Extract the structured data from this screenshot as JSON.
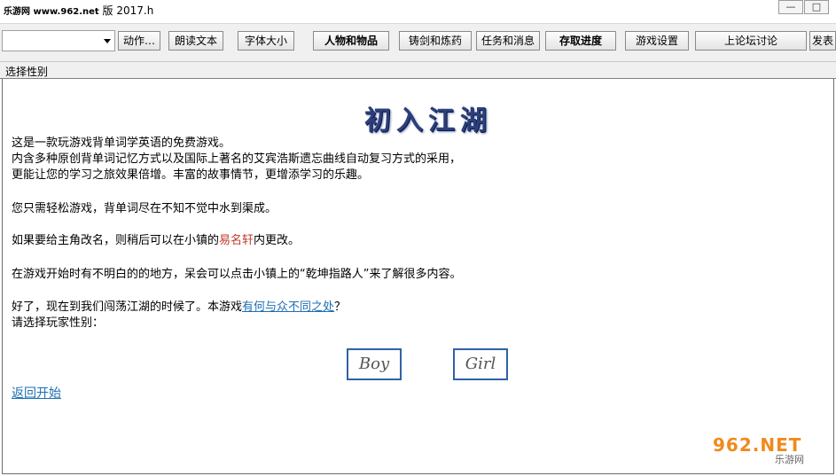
{
  "titlebar": {
    "site_label": "乐游网 www.962.net",
    "title_suffix": "版 2017.h",
    "minimize_glyph": "—",
    "maximize_glyph": "□"
  },
  "toolbar": {
    "combo_value": "",
    "buttons": [
      {
        "label": "动作…"
      },
      {
        "label": "朗读文本"
      },
      {
        "label": "字体大小"
      },
      {
        "label": "人物和物品"
      },
      {
        "label": "铸剑和炼药"
      },
      {
        "label": "任务和消息"
      },
      {
        "label": "存取进度"
      },
      {
        "label": "游戏设置"
      },
      {
        "label": "上论坛讨论"
      },
      {
        "label": "发表"
      }
    ]
  },
  "section_label": "选择性别",
  "content": {
    "heading": "初入江湖",
    "intro_lines": [
      "这是一款玩游戏背单词学英语的免费游戏。",
      "内含多种原创背单词记忆方式以及国际上著名的艾宾浩斯遗忘曲线自动复习方式的采用，",
      "更能让您的学习之旅效果倍增。丰富的故事情节，更增添学习的乐趣。"
    ],
    "relax_line": "您只需轻松游戏，背单词尽在不知不觉中水到渠成。",
    "rename": {
      "before": "如果要给主角改名，则稍后可以在小镇的",
      "highlight": "易名轩",
      "after": "内更改。"
    },
    "help_line": "在游戏开始时有不明白的的地方，呆会可以点击小镇上的“乾坤指路人”来了解很多内容。",
    "journey": {
      "before": "好了，现在到我们闯荡江湖的时候了。本游戏",
      "link": "有何与众不同之处",
      "after": "？"
    },
    "prompt": "请选择玩家性别：",
    "boy_label": "Boy",
    "girl_label": "Girl",
    "back_link": "返回开始"
  },
  "watermark": {
    "top": "962.NET",
    "bottom": "乐游网"
  },
  "colors": {
    "accent_blue": "#2f62a6",
    "link_blue": "#1f6fb3",
    "highlight_red": "#c0392b",
    "watermark_orange": "#f08a1c"
  }
}
